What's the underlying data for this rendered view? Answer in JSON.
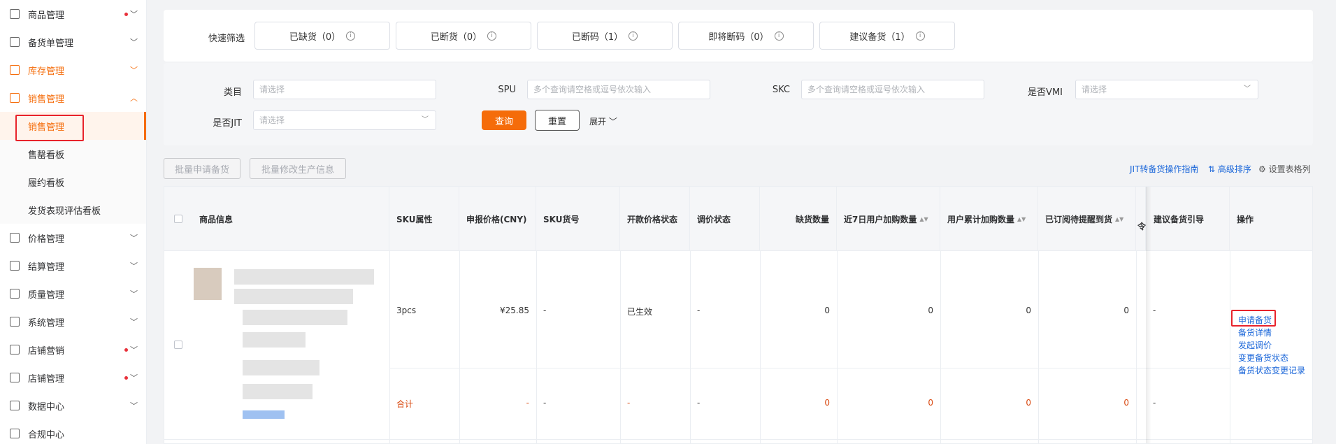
{
  "sidebar": {
    "items": [
      {
        "label": "商品管理",
        "icon": "box-icon",
        "dot": true
      },
      {
        "label": "备货单管理",
        "icon": "clipboard-icon",
        "dot": false
      },
      {
        "label": "库存管理",
        "icon": "warehouse-icon",
        "dot": false
      },
      {
        "label": "销售管理",
        "icon": "chart-icon",
        "dot": false,
        "expanded": true
      }
    ],
    "sub_items": [
      "销售管理",
      "售罄看板",
      "履约看板",
      "发货表现评估看板"
    ],
    "items_after": [
      {
        "label": "价格管理",
        "icon": "price-tag-icon",
        "dot": false
      },
      {
        "label": "结算管理",
        "icon": "card-icon",
        "dot": false
      },
      {
        "label": "质量管理",
        "icon": "shield-check-icon",
        "dot": false
      },
      {
        "label": "系统管理",
        "icon": "shield-icon",
        "dot": false
      },
      {
        "label": "店铺营销",
        "icon": "tag-icon",
        "dot": true
      },
      {
        "label": "店铺管理",
        "icon": "store-icon",
        "dot": true
      },
      {
        "label": "数据中心",
        "icon": "data-icon",
        "dot": false
      },
      {
        "label": "合规中心",
        "icon": "document-icon",
        "dot": false
      }
    ]
  },
  "quick_filter": {
    "label": "快速筛选",
    "buttons": [
      "已缺货（0）",
      "已断货（0）",
      "已断码（1）",
      "即将断码（0）",
      "建议备货（1）"
    ]
  },
  "filters": {
    "category_label": "类目",
    "category_placeholder": "请选择",
    "spu_label": "SPU",
    "spu_placeholder": "多个查询请空格或逗号依次输入",
    "skc_label": "SKC",
    "skc_placeholder": "多个查询请空格或逗号依次输入",
    "vmi_label": "是否VMI",
    "vmi_placeholder": "请选择",
    "jit_label": "是否JIT",
    "jit_placeholder": "请选择",
    "query_btn": "查询",
    "reset_btn": "重置",
    "expand": "展开"
  },
  "actions": {
    "batch_apply": "批量申请备货",
    "batch_edit": "批量修改生产信息",
    "jit_guide": "JIT转备货操作指南",
    "advanced_sort": "高级排序",
    "table_settings": "设置表格列"
  },
  "table": {
    "headers": [
      "商品信息",
      "SKU属性",
      "申报价格(CNY)",
      "SKU货号",
      "开款价格状态",
      "调价状态",
      "缺货数量",
      "近7日用户加购数量",
      "用户累计加购数量",
      "已订阅待提醒到货",
      "令",
      "建议备货引导",
      "操作"
    ],
    "row": {
      "sku_attr": "3pcs",
      "price": "¥25.85",
      "sku_code": "-",
      "price_status": "已生效",
      "adjust_status": "-",
      "shortage": "0",
      "cart_7d": "0",
      "cart_total": "0",
      "subscribed": "0",
      "guide": "-"
    },
    "total_row": {
      "label": "合计",
      "price": "-",
      "sku_code": "-",
      "price_status": "-",
      "adjust_status": "-",
      "shortage": "0",
      "cart_7d": "0",
      "cart_total": "0",
      "subscribed": "0",
      "guide": "-"
    },
    "operations": [
      "申请备货",
      "备货详情",
      "发起调价",
      "变更备货状态",
      "备货状态变更记录"
    ]
  },
  "colors": {
    "accent": "#f56c0a",
    "link": "#1a66d9",
    "highlight": "#e8232b"
  }
}
